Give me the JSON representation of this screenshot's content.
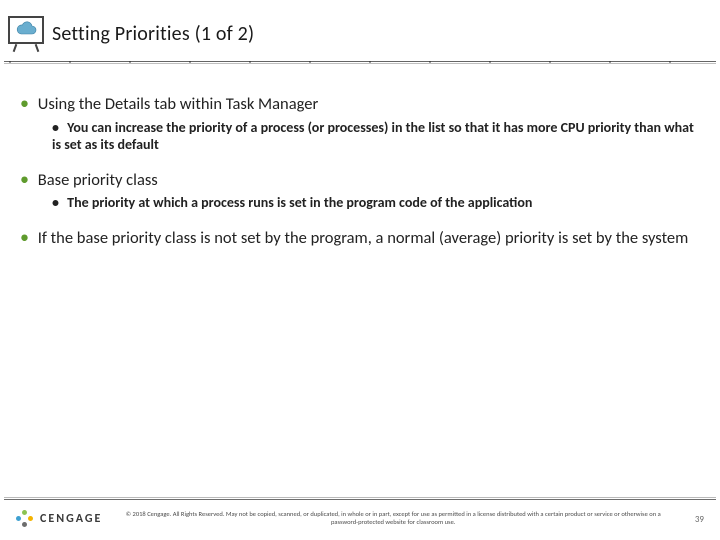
{
  "header": {
    "icon": "cloud-icon",
    "title": "Setting Priorities (1 of 2)"
  },
  "bullets": [
    {
      "text": "Using the Details tab within Task Manager",
      "children": [
        {
          "text": "You can increase the priority of a process (or processes) in the list so that it has more CPU priority than what is set as its default"
        }
      ]
    },
    {
      "text": "Base priority class",
      "children": [
        {
          "text": "The priority at which a process runs is set in the program code of the application"
        }
      ]
    },
    {
      "text": "If the base priority class is not set by the program, a normal (average) priority is set by the system",
      "children": []
    }
  ],
  "footer": {
    "brand": "CENGAGE",
    "copyright": "© 2018 Cengage. All Rights Reserved. May not be copied, scanned, or duplicated, in whole or in part, except for use as permitted in a license distributed with a certain product or service or otherwise on a password-protected website for classroom use.",
    "page": "39"
  }
}
